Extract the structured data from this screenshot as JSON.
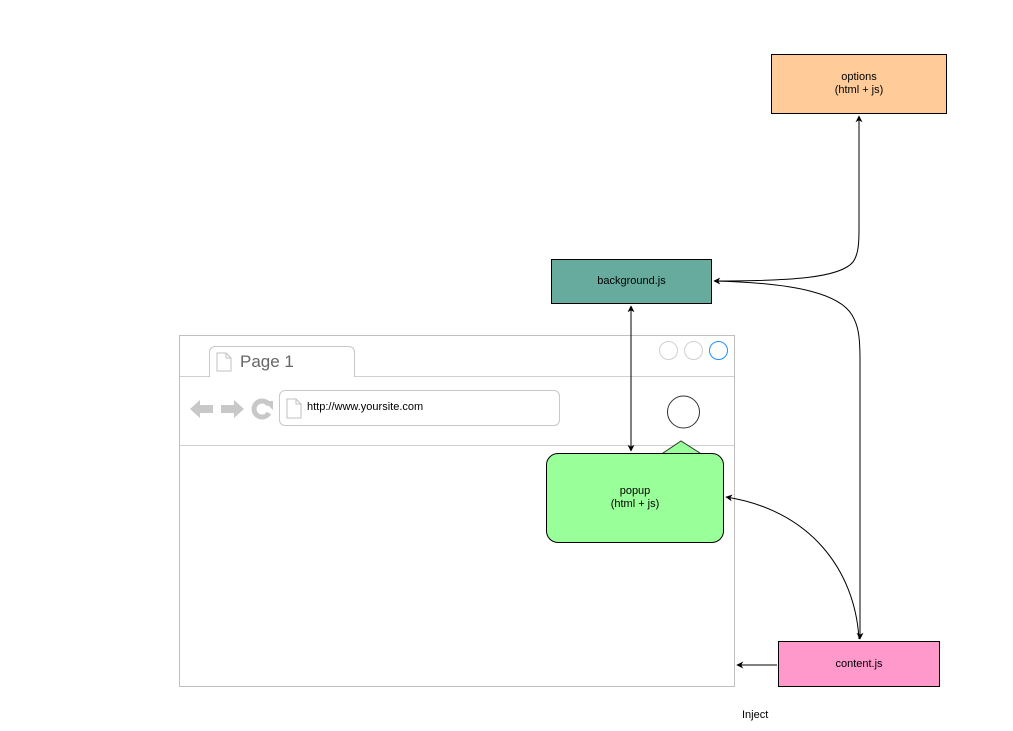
{
  "diagram": {
    "nodes": {
      "options": {
        "line1": "options",
        "line2": "(html + js)",
        "color": "#FFCC99"
      },
      "background": {
        "label": "background.js",
        "color": "#67AB9F"
      },
      "popup": {
        "line1": "popup",
        "line2": "(html + js)",
        "color": "#99FF99"
      },
      "content": {
        "label": "content.js",
        "color": "#FF99CC"
      }
    },
    "browser_mockup": {
      "tab_label": "Page 1",
      "url": "http://www.yoursite.com",
      "icons": [
        "back-arrow-icon",
        "forward-arrow-icon",
        "reload-icon",
        "page-icon",
        "extension-button-icon"
      ],
      "window_buttons": [
        "minimize",
        "maximize",
        "close"
      ],
      "accent_color": "#1E90FF"
    },
    "edges": [
      {
        "from": "background",
        "to": "options",
        "style": "bidirectional-curve"
      },
      {
        "from": "background",
        "to": "popup",
        "style": "bidirectional"
      },
      {
        "from": "background",
        "to": "content",
        "style": "bidirectional-curve"
      },
      {
        "from": "content",
        "to": "popup",
        "style": "bidirectional-curve"
      },
      {
        "from": "content",
        "to": "browser",
        "style": "arrow",
        "label": "Inject"
      }
    ],
    "inject_label": "Inject"
  }
}
